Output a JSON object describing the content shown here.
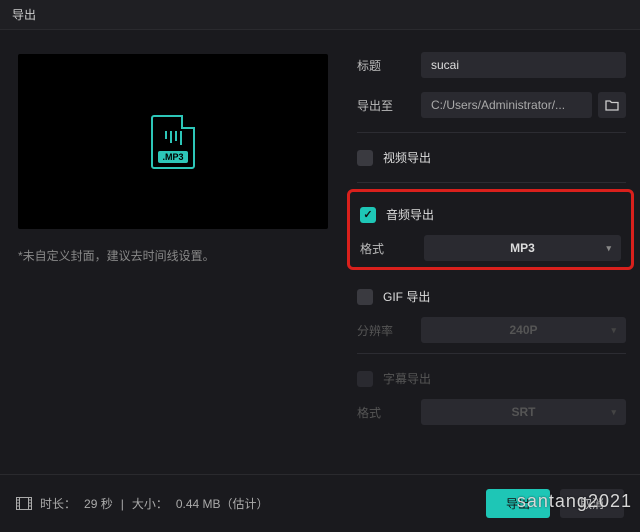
{
  "titlebar": {
    "title": "导出"
  },
  "preview": {
    "ext_label": ".MP3"
  },
  "hint": "*未自定义封面，建议去时间线设置。",
  "fields": {
    "title_label": "标题",
    "title_value": "sucai",
    "export_to_label": "导出至",
    "export_to_value": "C:/Users/Administrator/..."
  },
  "sections": {
    "video": {
      "label": "视频导出",
      "checked": false
    },
    "audio": {
      "label": "音频导出",
      "checked": true,
      "format_label": "格式",
      "format_value": "MP3"
    },
    "gif": {
      "label": "GIF 导出",
      "checked": false,
      "resolution_label": "分辨率",
      "resolution_value": "240P"
    },
    "subtitle": {
      "label": "字幕导出",
      "checked": false,
      "format_label": "格式",
      "format_value": "SRT"
    }
  },
  "footer": {
    "duration_label": "时长：",
    "duration_value": "29 秒",
    "size_label": "大小：",
    "size_value": "0.44 MB（估计）",
    "export_btn": "导出",
    "cancel_btn": "取消"
  },
  "watermark": "santang2021"
}
